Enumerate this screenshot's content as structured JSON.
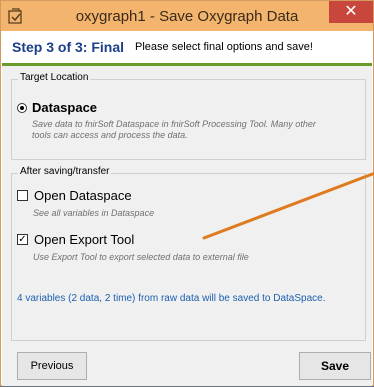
{
  "window": {
    "title": "oxygraph1 - Save Oxygraph Data",
    "close_glyph": "✕",
    "icon": "app-icon"
  },
  "step": {
    "title": "Step 3 of 3: Final",
    "description": "Please select final options and save!"
  },
  "target_location": {
    "legend": "Target Location",
    "option_label": "Dataspace",
    "option_desc_line1": "Save data to fnirSoft Dataspace in fnirSoft Processing Tool. Many other",
    "option_desc_line2": "tools can access and process the data.",
    "selected": true
  },
  "after_saving": {
    "legend": "After saving/transfer",
    "open_dataspace": {
      "label": "Open Dataspace",
      "desc": "See all variables in Dataspace",
      "checked": false
    },
    "open_export_tool": {
      "label": "Open Export Tool",
      "desc": "Use Export Tool to export selected data to external file",
      "checked": true
    }
  },
  "info_message": "4 variables (2 data, 2 time) from raw data will be saved to DataSpace.",
  "buttons": {
    "previous": "Previous",
    "save": "Save"
  },
  "colors": {
    "titlebar": "#f3b56e",
    "step_title": "#1c3f8a",
    "step_rule": "#6a9a2a",
    "info_text": "#1c5fb0",
    "annotation_line": "#e07a1f"
  }
}
